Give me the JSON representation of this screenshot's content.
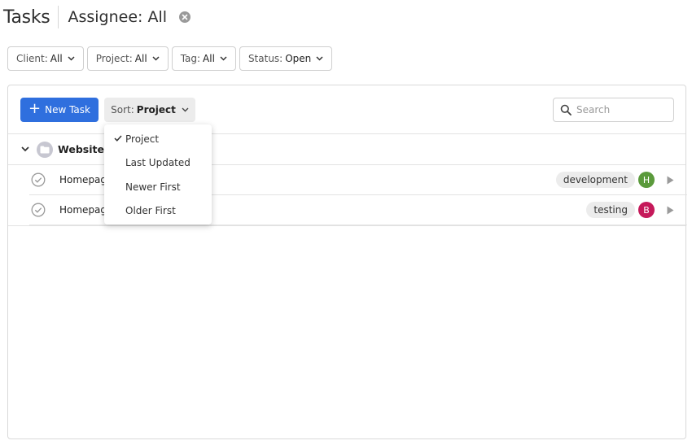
{
  "header": {
    "title": "Tasks",
    "assignee": "Assignee: All"
  },
  "filters": [
    {
      "label": "Client:",
      "value": "All"
    },
    {
      "label": "Project:",
      "value": "All"
    },
    {
      "label": "Tag:",
      "value": "All"
    },
    {
      "label": "Status:",
      "value": "Open"
    }
  ],
  "toolbar": {
    "new_task_label": "New Task",
    "sort_label": "Sort:",
    "sort_value": "Project",
    "search_placeholder": "Search"
  },
  "group": {
    "name": "Website d"
  },
  "tasks": [
    {
      "name": "Homepage",
      "tag": "development",
      "avatar": "H",
      "avatar_color": "#5b9a3c"
    },
    {
      "name": "Homepage",
      "tag": "testing",
      "avatar": "B",
      "avatar_color": "#c5195a"
    }
  ],
  "sort_menu": {
    "selected": "Project",
    "items": [
      "Project",
      "Last Updated",
      "Newer First",
      "Older First"
    ]
  },
  "colors": {
    "primary": "#2f6fde",
    "border": "#d9d9d9"
  }
}
